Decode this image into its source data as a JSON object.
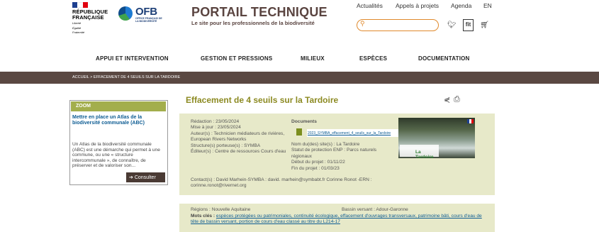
{
  "header": {
    "republique": [
      "RÉPUBLIQUE",
      "FRANÇAISE"
    ],
    "motto": [
      "Liberté",
      "Égalité",
      "Fraternité"
    ],
    "ofb": "OFB",
    "ofb_sub": "OFFICE FRANÇAIS DE LA BIODIVERSITÉ",
    "portal_title": "PORTAIL TECHNIQUE",
    "portal_subtitle": "Le site pour les professionnels de la biodiversité",
    "top_links": [
      "Actualités",
      "Appels à projets",
      "Agenda",
      "EN"
    ],
    "logo_box_text": "fit",
    "colors": {
      "accent": "#e08a2d",
      "brown": "#5a4842",
      "olive": "#a3ae4c"
    }
  },
  "nav": [
    "APPUI ET INTERVENTION",
    "GESTION ET PRESSIONS",
    "MILIEUX",
    "ESPÈCES",
    "DOCUMENTATION"
  ],
  "breadcrumb": "ACCUEIL  >  EFFACEMENT DE 4 SEUILS SUR LA TARDOIRE",
  "sidebar": {
    "zoom_label": "ZOOM",
    "title": "Mettre en place un Atlas de la biodiversité communale (ABC)",
    "text": "Un Atlas de la biodiversité communale (ABC) est une démarche qui permet à une commune, ou une « structure intercommunale », de connaître, de préserver et de valoriser son...",
    "button": "Consulter"
  },
  "main": {
    "title": "Effacement de 4 seuils sur la Tardoire",
    "redaction": "Rédaction : 23/05/2024",
    "mise_a_jour": "Mise à jour : 23/05/2024",
    "auteurs": "Auteur(s) : Technicien médiateurs de rivières, European Rivers Networks",
    "structures": "Structure(s) porteuse(s) : SYMBA",
    "editeurs": "Éditeur(s) : Centre de ressources Cours d'eau",
    "contacts": "Contact(s) : David Marhein-SYMBA : david. marhein@symbabt.fr Corinne Ronot -ERN : corinne.ronot@rivernet.org",
    "documents_label": "Documents",
    "document_file": "2023_SYMBA_effacement_4_seuils_sur_la_Tardoire",
    "site": "Nom du(des) site(s) : La Tardoire",
    "statut": "Statut de protection ENP : Parcs naturels régionaux",
    "debut": "Début du projet : 01/11/22",
    "fin": "Fin du projet : 01/03/23",
    "photo_label": "La Tardoire",
    "regions": "Régions : Nouvelle Aquitaine",
    "bassin": "Bassin versant : Adour-Garonne",
    "mots_cles_label": "Mots clés :",
    "mots_cles": "espèces protégées ou patrimoniales, continuité écologique, effacement d'ouvrages transversaux, patrimoine bâti, cours d'eau de tête de bassin versant, portion de cours d'eau classé au titre du L214-17"
  }
}
